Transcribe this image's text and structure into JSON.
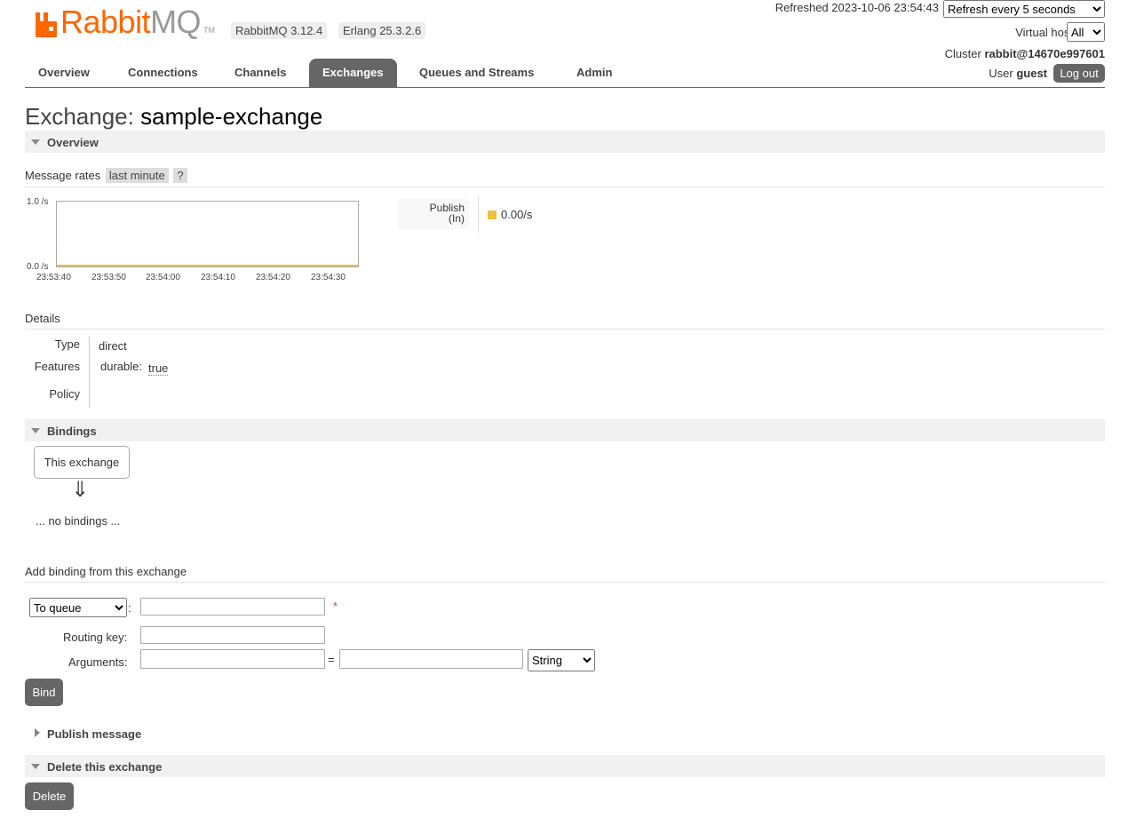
{
  "header": {
    "brand_primary": "Rabbit",
    "brand_secondary": "MQ",
    "brand_tm": "TM",
    "rabbitmq_version": "RabbitMQ 3.12.4",
    "erlang_version": "Erlang 25.3.2.6",
    "refreshed": "Refreshed 2023-10-06 23:54:43",
    "refresh_option": "Refresh every 5 seconds",
    "virtual_host_label": "Virtual host",
    "virtual_host_value": "All",
    "cluster_label": "Cluster",
    "cluster_name": "rabbit@14670e997601",
    "user_label": "User",
    "user_name": "guest",
    "logout_label": "Log out",
    "brand_color": "#ff6600"
  },
  "nav": {
    "items": [
      "Overview",
      "Connections",
      "Channels",
      "Exchanges",
      "Queues and Streams",
      "Admin"
    ],
    "active": "Exchanges"
  },
  "page": {
    "title_prefix": "Exchange:",
    "title_name": "sample-exchange"
  },
  "overview": {
    "section_label": "Overview",
    "rates_label": "Message rates",
    "rates_period": "last minute",
    "help": "?",
    "legend_label_line1": "Publish",
    "legend_label_line2": "(In)",
    "legend_value": "0.00/s",
    "legend_color": "#edc240"
  },
  "chart_data": {
    "type": "line",
    "y_tick_labels": [
      "1.0 /s",
      "0.0 /s"
    ],
    "ylim": [
      0,
      1
    ],
    "categories": [
      "23:53:40",
      "23:53:50",
      "23:54:00",
      "23:54:10",
      "23:54:20",
      "23:54:30"
    ],
    "series": [
      {
        "name": "Publish (In)",
        "values": [
          0,
          0,
          0,
          0,
          0,
          0
        ],
        "color": "#edc240"
      }
    ]
  },
  "details": {
    "label": "Details",
    "type_key": "Type",
    "type_value": "direct",
    "features_key": "Features",
    "durable_key": "durable:",
    "durable_value": "true",
    "policy_key": "Policy"
  },
  "bindings": {
    "section_label": "Bindings",
    "this_exchange": "This exchange",
    "arrow": "⇓",
    "empty": "... no bindings ..."
  },
  "add_binding": {
    "label": "Add binding from this exchange",
    "destination_type": "To queue",
    "required_mark": "*",
    "routing_key_label": "Routing key:",
    "arguments_label": "Arguments:",
    "equals": "=",
    "arg_type": "String",
    "bind_label": "Bind",
    "colon": ":"
  },
  "publish": {
    "section_label": "Publish message"
  },
  "delete": {
    "section_label": "Delete this exchange",
    "button_label": "Delete"
  }
}
